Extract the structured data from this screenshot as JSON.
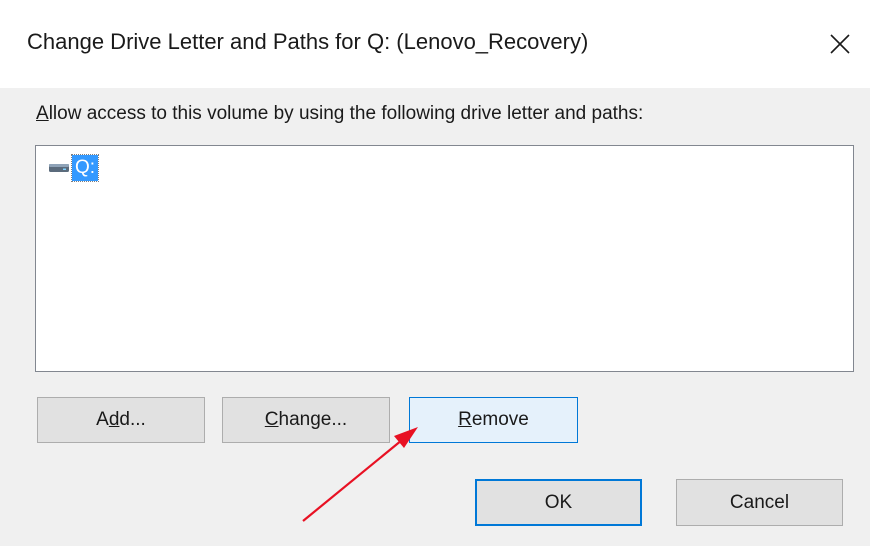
{
  "window": {
    "title": "Change Drive Letter and Paths for Q: (Lenovo_Recovery)",
    "close_glyph": "✕"
  },
  "prompt": {
    "accel": "A",
    "rest": "llow access to this volume by using the following drive letter and paths:"
  },
  "list": {
    "items": [
      {
        "label": "Q:",
        "icon": "drive-icon",
        "selected": true
      }
    ]
  },
  "buttons": {
    "add": {
      "pre": "A",
      "accel": "d",
      "post": "d..."
    },
    "change": {
      "pre": "",
      "accel": "C",
      "post": "hange..."
    },
    "remove": {
      "pre": "",
      "accel": "R",
      "post": "emove"
    },
    "ok": {
      "label": "OK"
    },
    "cancel": {
      "label": "Cancel"
    }
  },
  "annotation": {
    "type": "arrow",
    "color": "#e81123",
    "points_to": "remove-button"
  },
  "colors": {
    "selection": "#3399ff",
    "focus_border": "#0078d7",
    "hover_bg": "#e5f1fb"
  }
}
